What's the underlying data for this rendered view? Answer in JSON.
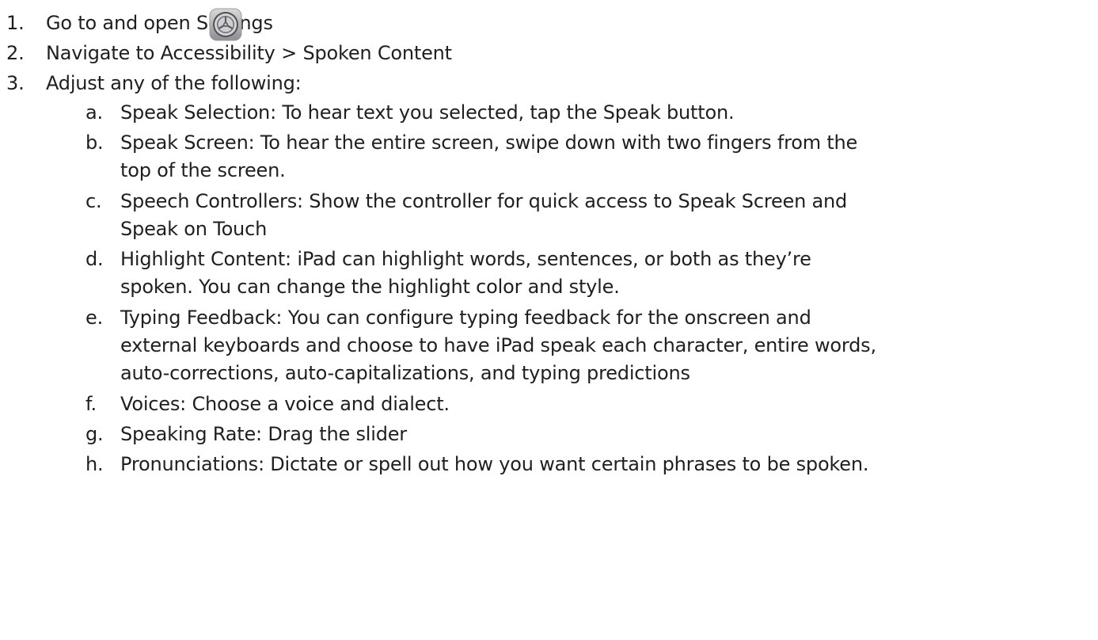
{
  "steps": [
    {
      "number": "1.",
      "text": "Go to and open Settings",
      "icon": "settings-gear-icon"
    },
    {
      "number": "2.",
      "text": "Navigate to Accessibility > Spoken Content"
    },
    {
      "number": "3.",
      "text": "Adjust any of the following:"
    }
  ],
  "substeps": [
    {
      "letter": "a.",
      "lines": [
        "Speak Selection: To hear text you selected, tap the Speak button."
      ]
    },
    {
      "letter": "b.",
      "lines": [
        "Speak Screen: To hear the entire screen, swipe down with two fingers from the",
        "top of the screen."
      ]
    },
    {
      "letter": "c.",
      "lines": [
        "Speech Controllers: Show the controller for quick access to Speak Screen and",
        "Speak on Touch"
      ]
    },
    {
      "letter": "d.",
      "lines": [
        "Highlight Content: iPad can highlight words, sentences, or both as they’re",
        "spoken. You can change the highlight color and style."
      ]
    },
    {
      "letter": "e.",
      "lines": [
        "Typing Feedback: You can configure typing feedback for the onscreen and",
        "external keyboards and choose to have iPad speak each character, entire words,",
        "auto-corrections, auto-capitalizations, and typing predictions"
      ]
    },
    {
      "letter": "f.",
      "lines": [
        "Voices: Choose a voice and dialect."
      ]
    },
    {
      "letter": "g.",
      "lines": [
        "Speaking Rate: Drag the slider"
      ]
    },
    {
      "letter": "h.",
      "lines": [
        "Pronunciations: Dictate or spell out how you want certain phrases to be spoken."
      ]
    }
  ]
}
